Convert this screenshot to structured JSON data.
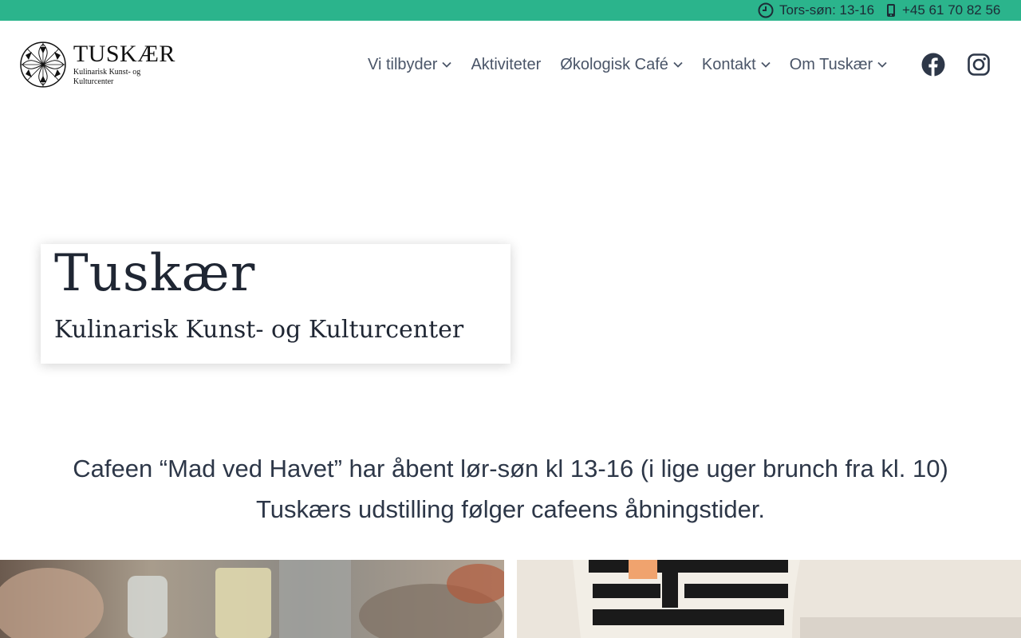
{
  "topbar": {
    "hours": "Tors-søn: 13-16",
    "phone": "+45 61 70 82 56",
    "hours_icon": "clock-icon",
    "phone_icon": "mobile-phone-icon",
    "background": "#2bb48c"
  },
  "logo": {
    "title": "TUSKÆR",
    "subtitle": "Kulinarisk Kunst- og Kulturcenter"
  },
  "nav": {
    "items": [
      {
        "label": "Vi tilbyder",
        "has_dropdown": true
      },
      {
        "label": "Aktiviteter",
        "has_dropdown": false
      },
      {
        "label": "Økologisk Café",
        "has_dropdown": true
      },
      {
        "label": "Kontakt",
        "has_dropdown": true
      },
      {
        "label": "Om Tuskær",
        "has_dropdown": true
      }
    ],
    "social": [
      "facebook-icon",
      "instagram-icon"
    ]
  },
  "hero": {
    "title": "Tuskær",
    "subtitle": "Kulinarisk Kunst- og Kulturcenter"
  },
  "notice": {
    "line1": "Cafeen “Mad ved Havet” har åbent lør-søn kl 13-16 (i lige uger brunch fra kl. 10)",
    "line2": "Tuskærs udstilling følger cafeens åbningstider."
  },
  "colors": {
    "accent": "#2bb48c",
    "text": "#2d3748",
    "nav_text": "#4a5568"
  }
}
